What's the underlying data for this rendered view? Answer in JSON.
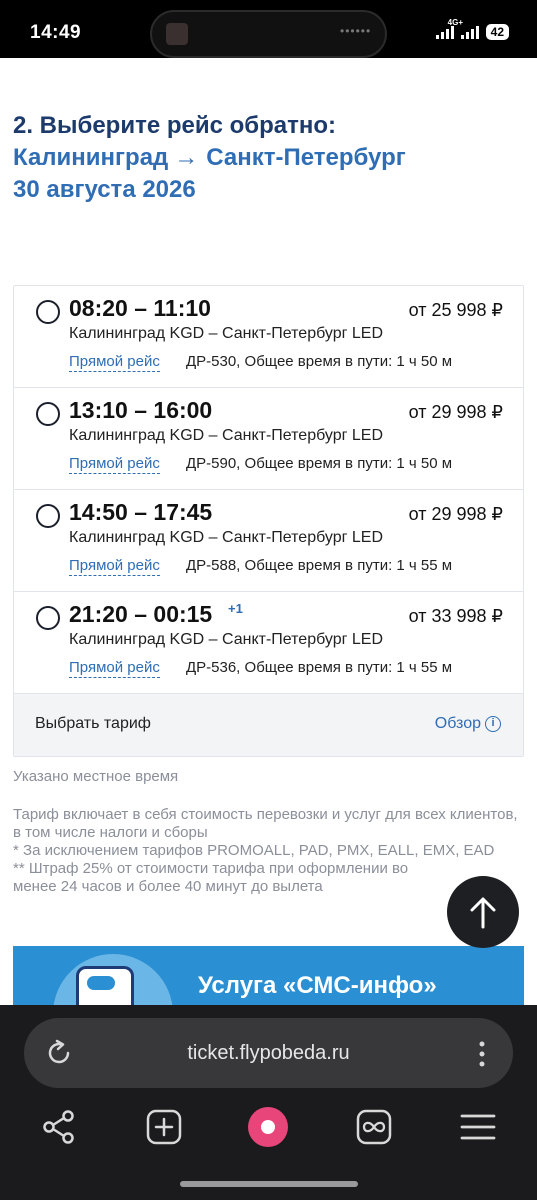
{
  "status": {
    "time": "14:49",
    "network": "4G+",
    "battery": "42"
  },
  "page": {
    "heading": "2. Выберите рейс обратно:",
    "route_from": "Калининград",
    "route_arrow": "→",
    "route_to": "Санкт-Петербург",
    "date": "30 августа 2026"
  },
  "flights": [
    {
      "times": "08:20 – 11:10",
      "plus_day": "",
      "price": "от 25 998 ₽",
      "airports": "Калининград KGD – Санкт-Петербург LED",
      "direct": "Прямой рейс",
      "details": "ДР-530, Общее время в пути: 1 ч 50 м"
    },
    {
      "times": "13:10 – 16:00",
      "plus_day": "",
      "price": "от 29 998 ₽",
      "airports": "Калининград KGD – Санкт-Петербург LED",
      "direct": "Прямой рейс",
      "details": "ДР-590, Общее время в пути: 1 ч 50 м"
    },
    {
      "times": "14:50 – 17:45",
      "plus_day": "",
      "price": "от 29 998 ₽",
      "airports": "Калининград KGD – Санкт-Петербург LED",
      "direct": "Прямой рейс",
      "details": "ДР-588, Общее время в пути: 1 ч 55 м"
    },
    {
      "times": "21:20 – 00:15",
      "plus_day": "+1",
      "price": "от 33 998 ₽",
      "airports": "Калининград KGD – Санкт-Петербург LED",
      "direct": "Прямой рейс",
      "details": "ДР-536, Общее время в пути: 1 ч 55 м"
    }
  ],
  "tariff": {
    "label": "Выбрать тариф",
    "overview": "Обзор"
  },
  "notes": {
    "local_time": "Указано местное время",
    "tariff_1": "Тариф включает в себя стоимость перевозки и услуг для всех клиентов, в том числе налоги и сборы",
    "tariff_2": "* За исключением тарифов PROMOALL, PAD, PMX, EALL, EMX, EAD",
    "tariff_3": "** Штраф 25% от стоимости тарифа при оформлении во",
    "tariff_4": "менее 24 часов и более 40 минут до вылета"
  },
  "banner": {
    "text": "Услуга «СМС-инфо»"
  },
  "browser": {
    "url": "ticket.flypobeda.ru"
  },
  "icons": {
    "reload": "reload-icon",
    "menu": "more-vertical-icon",
    "share": "share-icon",
    "new_tab": "new-tab-icon",
    "assistant": "assistant-icon",
    "tabs": "tabs-icon",
    "menu_main": "hamburger-menu-icon",
    "scroll_top": "arrow-up-icon"
  },
  "colors": {
    "heading": "#1c3a6b",
    "accent": "#2f6db4",
    "banner": "#2b8fd3"
  }
}
